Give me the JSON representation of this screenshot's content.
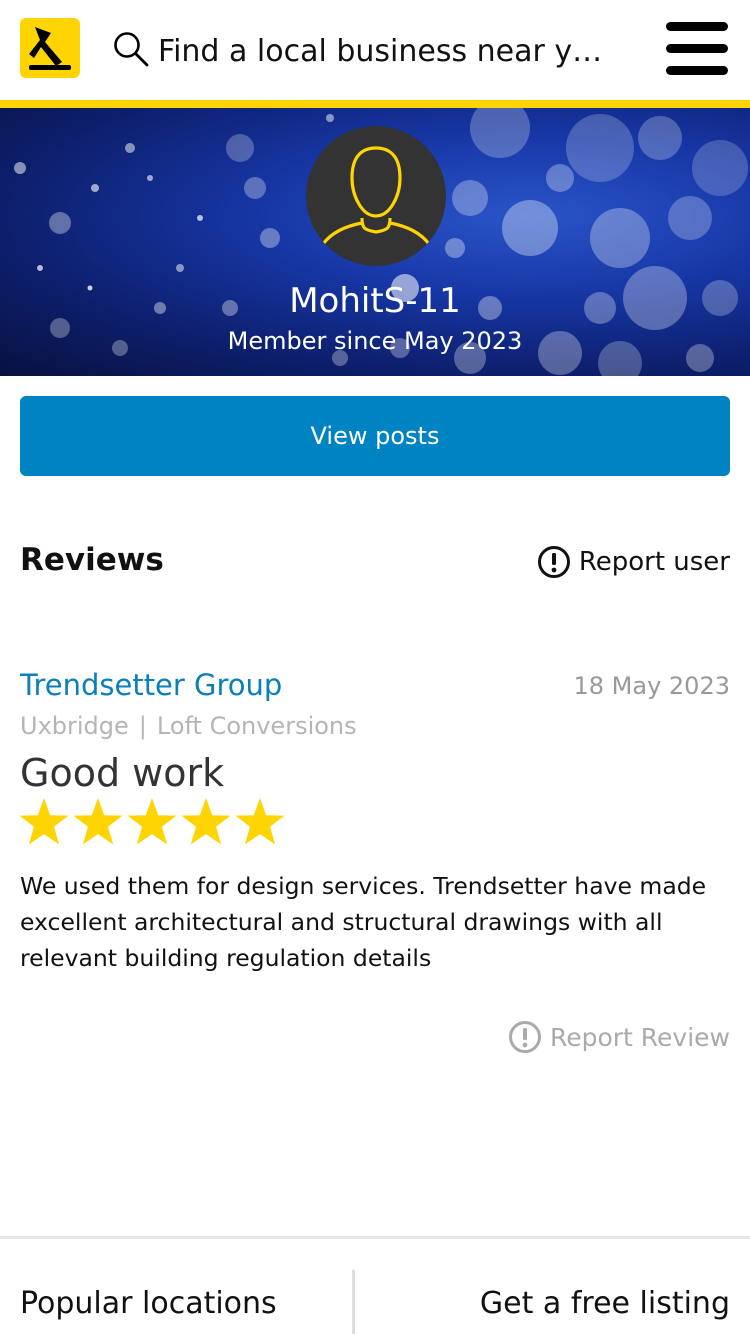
{
  "header": {
    "logo_icon": "yell-logo-icon",
    "search_placeholder": "Find a local business near yo...",
    "search_icon": "search-icon",
    "menu_icon": "hamburger-menu-icon",
    "accent": "#ffd400"
  },
  "profile": {
    "username": "MohitS-11",
    "member_since": "Member since May 2023",
    "avatar_icon": "user-avatar-icon"
  },
  "actions": {
    "view_posts": "View posts",
    "button_color": "#0083c3"
  },
  "reviews": {
    "title": "Reviews",
    "report_user": "Report user",
    "items": [
      {
        "business": "Trendsetter Group",
        "date": "18 May 2023",
        "location": "Uxbridge",
        "separator": "|",
        "category": "Loft Conversions",
        "title": "Good work",
        "rating": 5,
        "text": "We used them for design services. Trendsetter have made excellent architectural and structural drawings with all relevant building regulation details",
        "report": "Report Review"
      }
    ]
  },
  "footer": {
    "left": "Popular locations",
    "right": "Get a free listing"
  }
}
